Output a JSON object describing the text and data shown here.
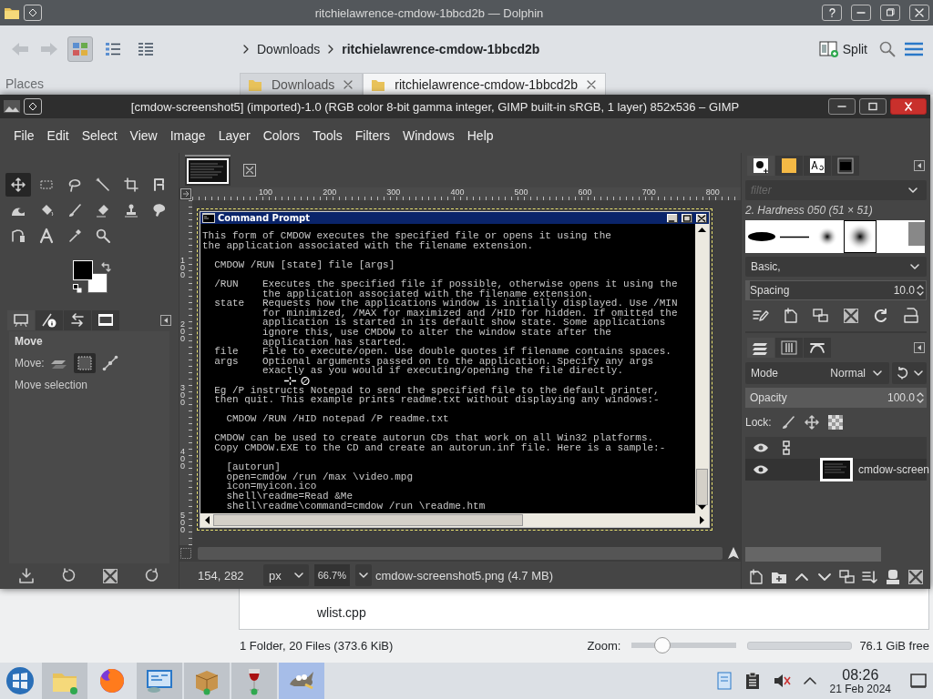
{
  "dolphin": {
    "title": "ritchielawrence-cmdow-1bbcd2b — Dolphin",
    "view_modes": [
      {
        "selected": true
      },
      {
        "selected": false
      },
      {
        "selected": false
      }
    ],
    "breadcrumb": [
      "Downloads",
      "ritchielawrence-cmdow-1bbcd2b"
    ],
    "split_label": "Split",
    "places_label": "Places",
    "tabs": [
      {
        "label": "Downloads",
        "selected": false
      },
      {
        "label": "ritchielawrence-cmdow-1bbcd2b",
        "selected": true
      }
    ],
    "files": [
      "wlist.cpp"
    ],
    "status": "1 Folder, 20 Files (373.6 KiB)",
    "zoom": {
      "label": "Zoom:",
      "level": 0.29
    },
    "free_space": "76.1 GiB free"
  },
  "gimp": {
    "title": "[cmdow-screenshot5] (imported)-1.0 (RGB color 8-bit gamma integer, GIMP built-in sRGB, 1 layer) 852x536 – GIMP",
    "menu": [
      "File",
      "Edit",
      "Select",
      "View",
      "Image",
      "Layer",
      "Colors",
      "Tools",
      "Filters",
      "Windows",
      "Help"
    ],
    "tools": [
      {
        "selected": true
      },
      {
        "selected": false
      },
      {
        "selected": false
      },
      {
        "selected": false
      },
      {
        "selected": false
      },
      {
        "selected": false
      },
      {
        "selected": false
      },
      {
        "selected": false
      },
      {
        "selected": false
      },
      {
        "selected": false
      },
      {
        "selected": false
      },
      {
        "selected": false
      },
      {
        "selected": false
      },
      {
        "selected": false
      },
      {
        "selected": false
      },
      {
        "selected": false
      }
    ],
    "tool_options": {
      "tabs": [
        {
          "selected": true
        },
        {
          "selected": false
        },
        {
          "selected": false
        },
        {
          "selected": false
        }
      ],
      "title": "Move",
      "move_label": "Move:",
      "move_modes": [
        {
          "selected": false
        },
        {
          "selected": true
        },
        {
          "selected": false
        }
      ],
      "mode_text": "Move selection"
    },
    "ruler_h": [
      "100",
      "200",
      "300",
      "400",
      "500",
      "600",
      "700",
      "800"
    ],
    "ruler_v": [
      "100",
      "200",
      "300",
      "400",
      "500"
    ],
    "image": {
      "window_title": "Command Prompt",
      "paragraphs": [
        [
          "This form of CMDOW executes the specified file or opens it using the",
          "the application associated with the filename extension."
        ],
        [
          "  CMDOW /RUN [state] file [args]"
        ],
        [
          "  /RUN    Executes the specified file if possible, otherwise opens it using the",
          "          the application associated with the filename extension.",
          "  state   Requests how the applications window is initially displayed. Use /MIN",
          "          for minimized, /MAX for maximized and /HID for hidden. If omitted the",
          "          application is started in its default show state. Some applications",
          "          ignore this, use CMDOW to alter the window state after the",
          "          application has started.",
          "  file    File to execute/open. Use double quotes if filename contains spaces.",
          "  args    Optional arguments passed on to the application. Specify any args",
          "          exactly as you would if executing/opening the file directly."
        ],
        [
          "  Eg /P instructs Notepad to send the specified file to the default printer,",
          "  then quit. This example prints readme.txt without displaying any windows:-"
        ],
        [
          "    CMDOW /RUN /HID notepad /P readme.txt"
        ],
        [
          "  CMDOW can be used to create autorun CDs that work on all Win32 platforms.",
          "  Copy CMDOW.EXE to the CD and create an autorun.inf file. Here is a sample:-"
        ],
        [
          "    [autorun]",
          "    open=cmdow /run /max \\video.mpg",
          "    icon=myicon.ico",
          "    shell\\readme=Read &Me",
          "    shell\\readme\\command=cmdow /run \\readme.htm"
        ]
      ]
    },
    "status": {
      "coords": "154, 282",
      "unit": "px",
      "zoom": "66.7%",
      "file_info": "cmdow-screenshot5.png (4.7 MB)"
    },
    "brushes": {
      "tabs": [
        {
          "selected": true
        },
        {
          "selected": false
        },
        {
          "selected": false
        },
        {
          "selected": false
        }
      ],
      "filter_placeholder": "filter",
      "brush_name": "2. Hardness 050 (51 × 51)",
      "items": [
        {
          "selected": false
        },
        {
          "selected": false
        },
        {
          "selected": false
        },
        {
          "selected": true
        }
      ],
      "preset": "Basic,",
      "spacing": {
        "label": "Spacing",
        "value": "10.0",
        "level": 0.02
      }
    },
    "layers": {
      "tabs": [
        {
          "selected": true
        },
        {
          "selected": false
        },
        {
          "selected": false
        }
      ],
      "mode_label": "Mode",
      "mode_value": "Normal",
      "opacity": {
        "label": "Opacity",
        "value": "100.0",
        "level": 1
      },
      "lock_label": "Lock:",
      "items": [
        {
          "name": "cmdow-screen",
          "visible": true
        }
      ]
    }
  },
  "taskbar": {
    "apps": [
      {
        "running": true,
        "active": false
      },
      {
        "running": false,
        "active": false
      },
      {
        "running": true,
        "active": false
      },
      {
        "running": true,
        "active": false
      },
      {
        "running": true,
        "active": false
      },
      {
        "running": true,
        "active": true
      }
    ],
    "time": "08:26",
    "date": "21 Feb 2024"
  }
}
